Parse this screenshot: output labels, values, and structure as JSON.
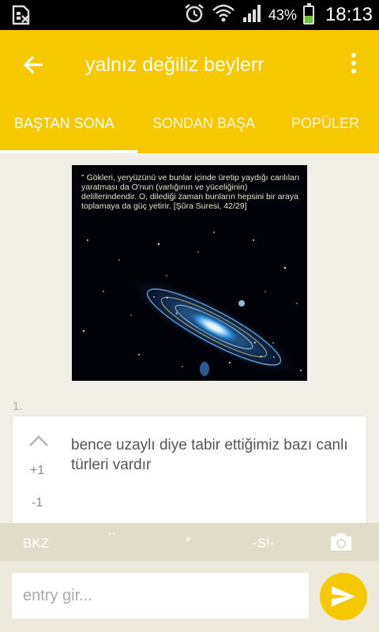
{
  "status_bar": {
    "battery_percent_label": "43%",
    "battery_level": 0.43,
    "time": "18:13",
    "icons": [
      "sim-card-off-icon",
      "alarm-icon",
      "wifi-icon",
      "signal-icon",
      "battery-icon"
    ]
  },
  "app_bar": {
    "title": "yalnız değiliz beylerr",
    "back_icon": "arrow-back-icon",
    "menu_icon": "more-vert-icon",
    "color": "#f5c800"
  },
  "tabs": [
    {
      "label": "BAŞTAN SONA",
      "selected": true
    },
    {
      "label": "SONDAN BAŞA",
      "selected": false
    },
    {
      "label": "POPÜLER",
      "selected": false
    }
  ],
  "image": {
    "caption": "\" Gökleri, yeryüzünü ve bunlar içinde üretip yaydığı canlıları yaratması da O'nun (varlığının ve yüceliğinin) delillerindendir. O, dilediği zaman bunların hepsini bir araya toplamaya da güç yetirir. [Şûra Suresi, 42/29]"
  },
  "entry": {
    "number": "1.",
    "text": "bence uzaylı diye tabir ettiğimiz bazı canlı türleri vardır",
    "plus_label": "+1",
    "minus_label": "-1"
  },
  "shortcuts": {
    "bkz": "BKZ",
    "backtick": "``",
    "star": "*",
    "spoiler": "-S!-",
    "camera_icon": "camera-icon"
  },
  "input": {
    "placeholder": "entry gir...",
    "value": ""
  },
  "send_icon": "send-icon"
}
